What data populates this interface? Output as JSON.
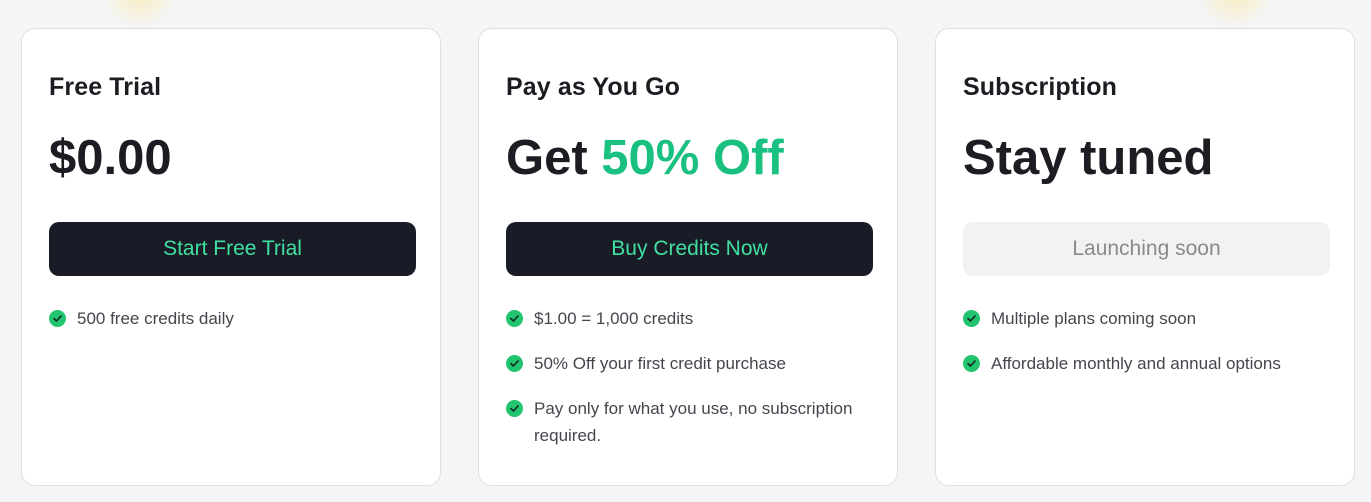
{
  "plans": [
    {
      "title": "Free Trial",
      "price": "$0.00",
      "price_prefix": "",
      "price_highlight": "",
      "button_label": "Start Free Trial",
      "features": [
        "500 free credits daily"
      ]
    },
    {
      "title": "Pay as You Go",
      "price": "",
      "price_prefix": "Get ",
      "price_highlight": "50% Off",
      "button_label": "Buy Credits Now",
      "features": [
        "$1.00 = 1,000 credits",
        "50% Off your first credit purchase",
        "Pay only for what you use, no subscription required."
      ]
    },
    {
      "title": "Subscription",
      "price": "Stay tuned",
      "price_prefix": "",
      "price_highlight": "",
      "button_label": "Launching soon",
      "features": [
        "Multiple plans coming soon",
        "Affordable monthly and annual options"
      ]
    }
  ],
  "icons": {
    "feature": "check-circle-icon"
  },
  "colors": {
    "accent": "#19c07f",
    "button_dark": "#191b27",
    "button_text": "#3fe0a0",
    "check": "#22c46f",
    "disabled_bg": "#f2f2f2",
    "disabled_text": "#8a8a8a"
  }
}
